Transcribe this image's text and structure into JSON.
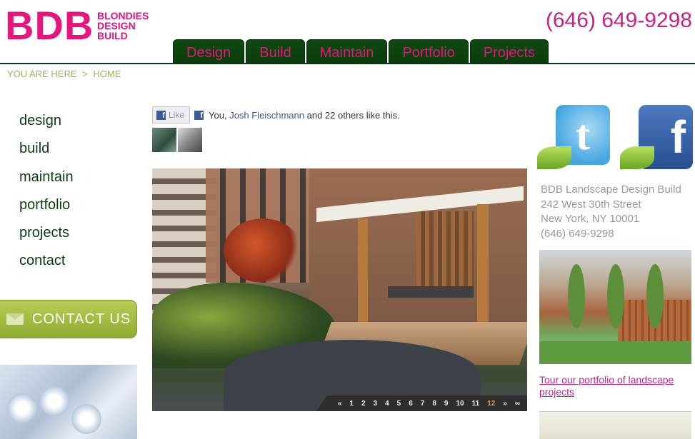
{
  "header": {
    "logo_letters": "BDB",
    "logo_line1": "BLONDIES",
    "logo_line2": "DESIGN",
    "logo_line3": "BUILD",
    "phone": "(646) 649-9298"
  },
  "nav": {
    "tabs": [
      "Design",
      "Build",
      "Maintain",
      "Portfolio",
      "Projects"
    ]
  },
  "breadcrumb": {
    "prefix": "YOU ARE HERE",
    "separator": ">",
    "current": "HOME"
  },
  "sidebar": {
    "links": [
      "design",
      "build",
      "maintain",
      "portfolio",
      "projects",
      "contact"
    ],
    "contact_button": "CONTACT US"
  },
  "facebook": {
    "like_label": "Like",
    "text_prefix": "You,",
    "name": "Josh Fleischmann",
    "text_suffix": "and 22 others like this.",
    "icon": "facebook-icon"
  },
  "slideshow": {
    "pages": [
      "1",
      "2",
      "3",
      "4",
      "5",
      "6",
      "7",
      "8",
      "9",
      "10",
      "11",
      "12"
    ],
    "active_page": "12",
    "prev_label": "«",
    "next_label": "»",
    "infinity_label": "∞"
  },
  "right": {
    "address_line1": "BDB Landscape Design Build",
    "address_line2": "242 West 30th Street",
    "address_line3": "New York, NY 10001",
    "address_line4": "(646) 649-9298",
    "tour_link": "Tour our portfolio of landscape projects"
  },
  "colors": {
    "brand_pink": "#e6147c",
    "nav_green": "#0a3a0c",
    "breadcrumb_green": "#8fb850"
  }
}
